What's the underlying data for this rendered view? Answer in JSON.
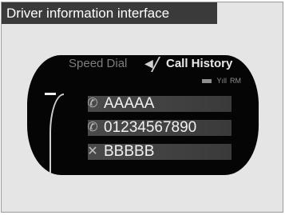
{
  "caption": "Driver information interface",
  "tabs": {
    "speed_dial": "Speed Dial",
    "call_history": "Call History",
    "arrow": "◀"
  },
  "status": {
    "signal": "Yıll",
    "roaming": "RM"
  },
  "calls": [
    {
      "label": "AAAAA",
      "type": "outgoing-call"
    },
    {
      "label": "01234567890",
      "type": "outgoing-call"
    },
    {
      "label": "BBBBB",
      "type": "missed-call"
    }
  ],
  "icons": {
    "outgoing": "✆",
    "missed": "✕"
  },
  "colors": {
    "screen": "#050505",
    "caption_bg": "#3a3a3a",
    "panel_bg": "#e5e5e5",
    "row_highlight": "#4a4a4a"
  }
}
